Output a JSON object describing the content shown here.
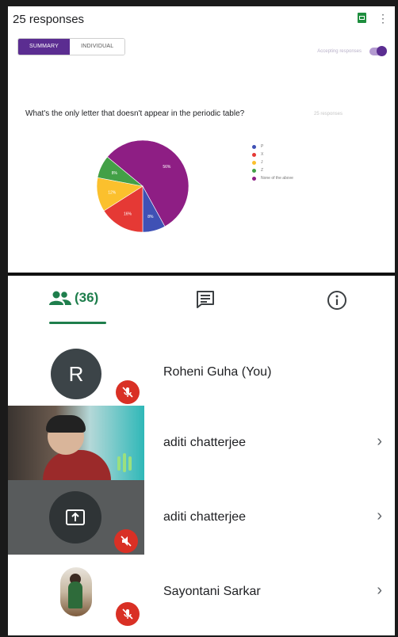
{
  "forms": {
    "responses_title": "25 responses",
    "tabs": [
      "SUMMARY",
      "INDIVIDUAL"
    ],
    "accepting_label": "Accepting responses",
    "question": "What's the only letter that doesn't appear in the periodic table?",
    "question_meta": "25 responses"
  },
  "chart_data": {
    "type": "pie",
    "categories": [
      "P",
      "X",
      "J",
      "Z",
      "None of the above"
    ],
    "values": [
      8,
      16,
      12,
      8,
      56
    ],
    "slice_labels": [
      "8%",
      "16%",
      "12%",
      "8%",
      "56%"
    ],
    "colors": [
      "#3f51b5",
      "#e53935",
      "#fbc02d",
      "#43a047",
      "#8e1e84"
    ]
  },
  "meet": {
    "people_count": "(36)",
    "participants": [
      {
        "name": "Roheni Guha (You)",
        "initial": "R"
      },
      {
        "name": "aditi chatterjee"
      },
      {
        "name": "aditi chatterjee"
      },
      {
        "name": "Sayontani Sarkar"
      }
    ],
    "chevron": "›"
  },
  "icons": [
    "people-icon",
    "chat-icon",
    "info-icon",
    "mic-off-icon",
    "present-screen-icon",
    "sheets-icon",
    "more-vert-icon"
  ]
}
